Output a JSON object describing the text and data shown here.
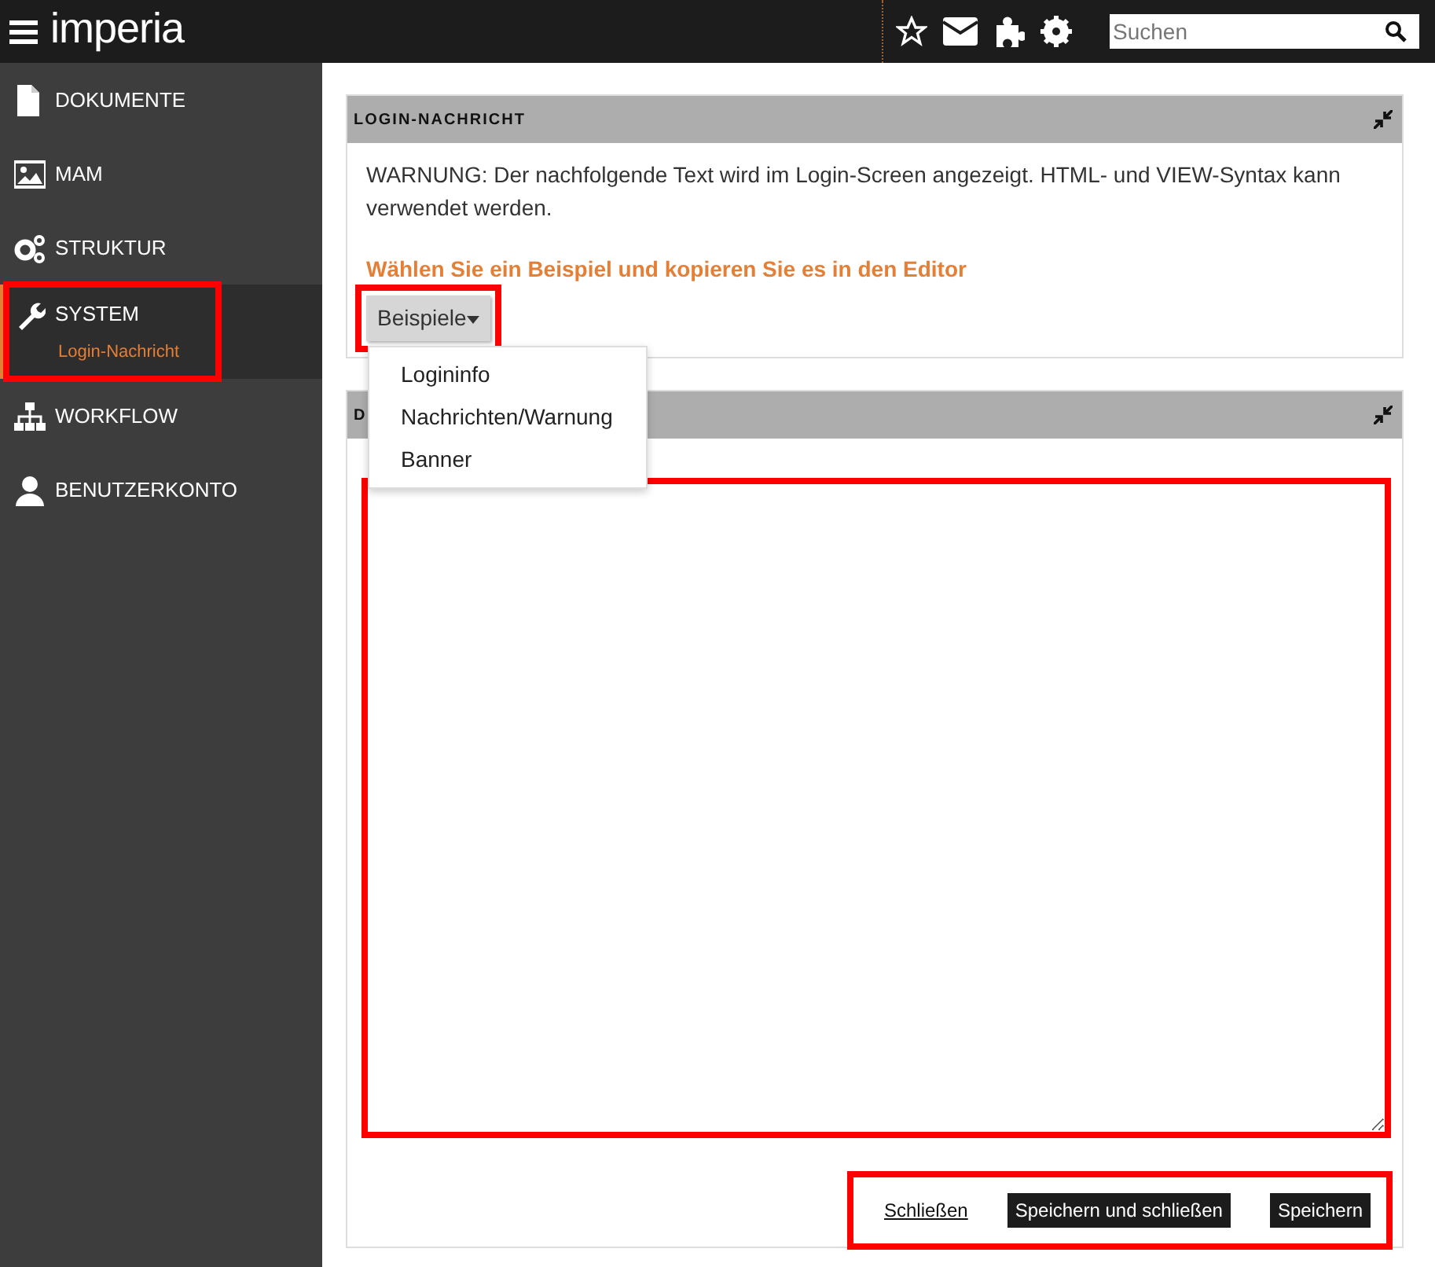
{
  "topbar": {
    "logo": "imperia",
    "search": {
      "placeholder": "Suchen"
    }
  },
  "sidebar": {
    "items": [
      {
        "label": "DOKUMENTE",
        "selected": false,
        "highlighted": false
      },
      {
        "label": "MAM",
        "selected": false,
        "highlighted": false
      },
      {
        "label": "STRUKTUR",
        "selected": false,
        "highlighted": false
      },
      {
        "label": "SYSTEM",
        "selected": true,
        "highlighted": true,
        "sub": "Login-Nachricht"
      },
      {
        "label": "WORKFLOW",
        "selected": false,
        "highlighted": false
      },
      {
        "label": "BENUTZERKONTO",
        "selected": false,
        "highlighted": false
      }
    ]
  },
  "panels": [
    {
      "title": "LOGIN-NACHRICHT",
      "text": "WARNUNG: Der nachfolgende Text wird im Login-Screen angezeigt. HTML- und VIEW-Syntax kann verwendet werden.",
      "prompt": "Wählen Sie ein Beispiel und kopieren Sie es in den Editor",
      "dropdown": {
        "label": "Beispiele",
        "highlighted": true,
        "expanded": true,
        "options": [
          "Logininfo",
          "Nachrichten/Warnung",
          "Banner"
        ]
      }
    },
    {
      "title": "D",
      "editor": {
        "highlighted": true
      },
      "footer": {
        "highlighted": true,
        "link": "Schließen",
        "buttons": [
          "Speichern und schließen",
          "Speichern"
        ]
      }
    }
  ]
}
